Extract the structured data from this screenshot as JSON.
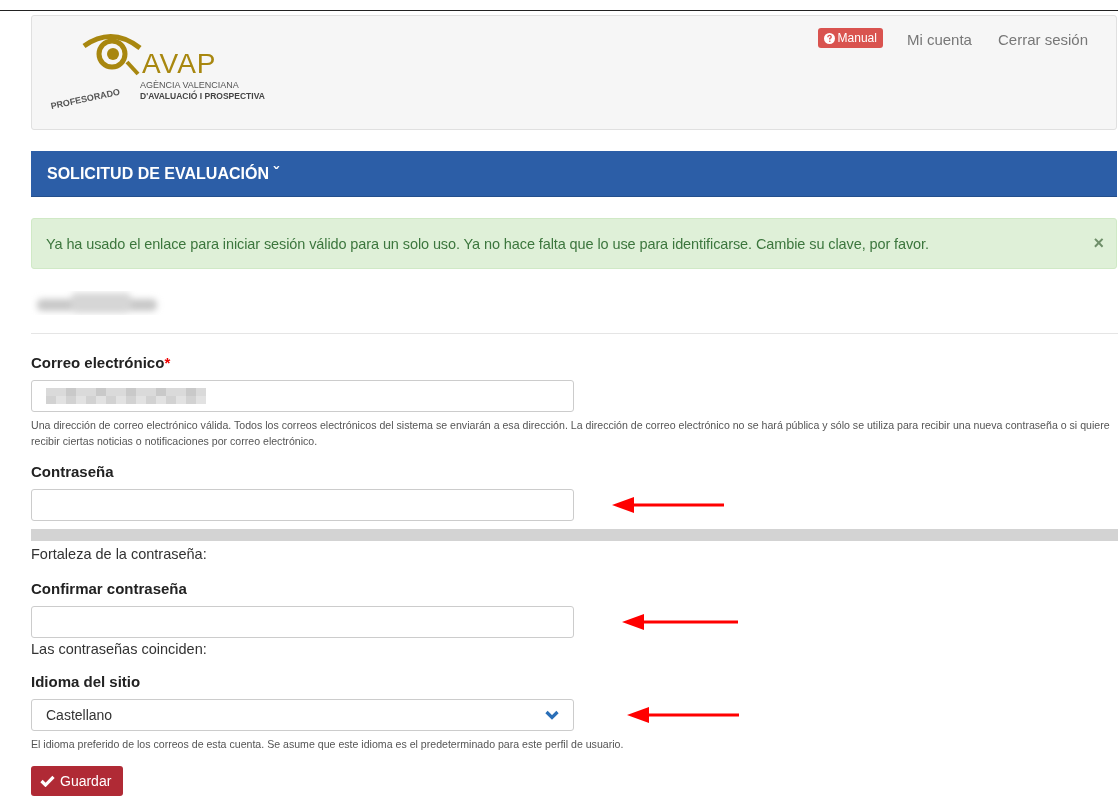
{
  "header": {
    "logo": {
      "wordmark": "AVAP",
      "line_1": "AGÈNCIA VALENCIANA",
      "line_2": "D'AVALUACIÓ I PROSPECTIVA",
      "stamp": "PROFESORADO"
    },
    "nav": [
      {
        "kind": "badge",
        "label": "Manual"
      },
      {
        "kind": "link",
        "label": "Mi cuenta"
      },
      {
        "kind": "link",
        "label": "Cerrar sesión"
      }
    ]
  },
  "menu_bar": {
    "label": "SOLICITUD DE EVALUACIÓN",
    "caret": "ˇ"
  },
  "alert": {
    "text": "Ya ha usado el enlace para iniciar sesión válido para un solo uso. Ya no hace falta que lo use para identificarse. Cambie su clave, por favor.",
    "close": "×"
  },
  "form": {
    "email": {
      "label": "Correo electrónico",
      "required_mark": "*",
      "help": "Una dirección de correo electrónico válida. Todos los correos electrónicos del sistema se enviarán a esa dirección. La dirección de correo electrónico no se hará pública y sólo se utiliza para recibir una nueva contraseña o si quiere recibir ciertas noticias o notificaciones por correo electrónico."
    },
    "password": {
      "label": "Contraseña",
      "arrow": true,
      "strength": {
        "level": 0,
        "label": "Fortaleza de la contraseña:"
      }
    },
    "confirm": {
      "label": "Confirmar contraseña",
      "arrow": true,
      "match_label": "Las contraseñas coinciden:"
    },
    "language": {
      "label": "Idioma del sitio",
      "value": "Castellano",
      "arrow": true,
      "help": "El idioma preferido de los correos de esta cuenta. Se asume que este idioma es el predeterminado para este perfil de usuario."
    },
    "save_button": "Guardar"
  }
}
